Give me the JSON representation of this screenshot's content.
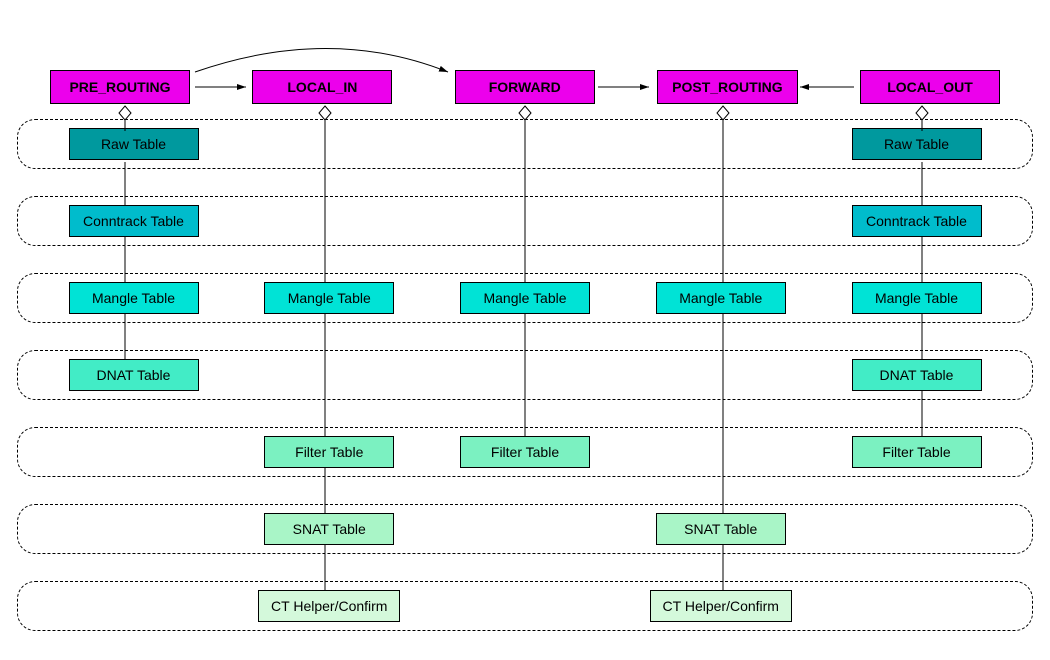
{
  "hooks": [
    {
      "id": "pre",
      "label": "PRE_ROUTING"
    },
    {
      "id": "in",
      "label": "LOCAL_IN"
    },
    {
      "id": "fwd",
      "label": "FORWARD"
    },
    {
      "id": "post",
      "label": "POST_ROUTING"
    },
    {
      "id": "out",
      "label": "LOCAL_OUT"
    }
  ],
  "rows": [
    {
      "id": "raw",
      "label": "Raw Table",
      "color": "c1",
      "columns": [
        "pre",
        null,
        null,
        null,
        "out"
      ]
    },
    {
      "id": "conntrk",
      "label": "Conntrack Table",
      "color": "c2",
      "columns": [
        "pre",
        null,
        null,
        null,
        "out"
      ]
    },
    {
      "id": "mangle",
      "label": "Mangle Table",
      "color": "c3",
      "columns": [
        "pre",
        "in",
        "fwd",
        "post",
        "out"
      ]
    },
    {
      "id": "dnat",
      "label": "DNAT Table",
      "color": "c4",
      "columns": [
        "pre",
        null,
        null,
        null,
        "out"
      ]
    },
    {
      "id": "filter",
      "label": "Filter Table",
      "color": "c5",
      "columns": [
        null,
        "in",
        "fwd",
        null,
        "out"
      ]
    },
    {
      "id": "snat",
      "label": "SNAT Table",
      "color": "c6",
      "columns": [
        null,
        "in",
        null,
        "post",
        null
      ]
    },
    {
      "id": "cthelp",
      "label": "CT Helper/Confirm",
      "color": "c7",
      "columns": [
        null,
        "in",
        null,
        "post",
        null
      ]
    }
  ],
  "flows": [
    {
      "from": "pre",
      "to": "in"
    },
    {
      "from": "pre",
      "to": "fwd",
      "curved": true
    },
    {
      "from": "fwd",
      "to": "post"
    },
    {
      "from": "out",
      "to": "post"
    }
  ]
}
